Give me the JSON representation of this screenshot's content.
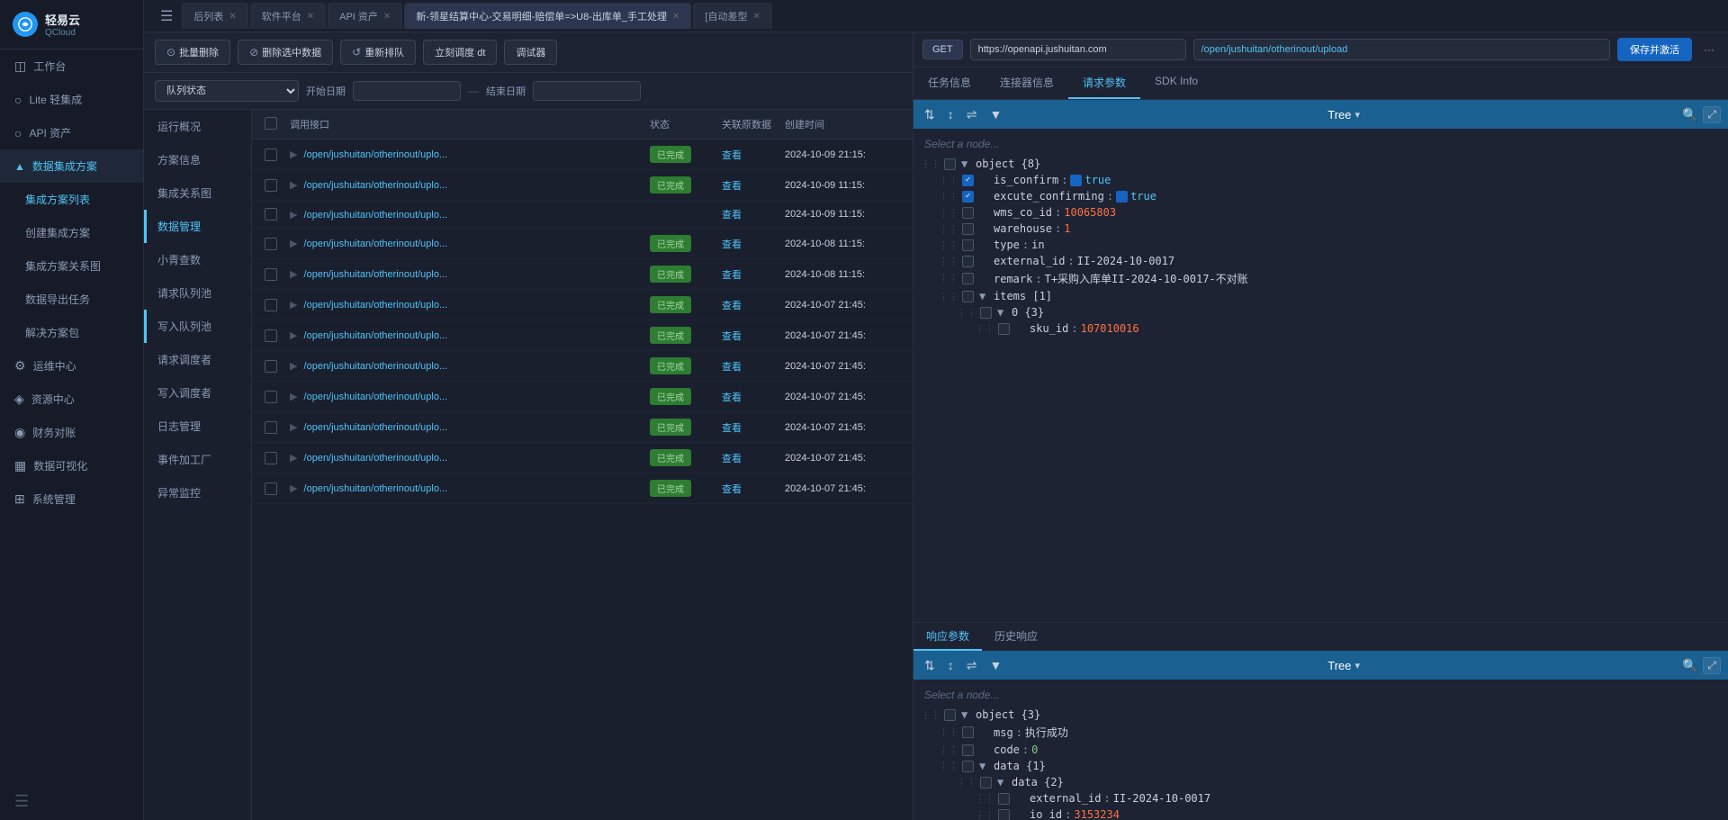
{
  "sidebar": {
    "logo": "轻易云",
    "logo_sub": "QCloud",
    "items": [
      {
        "id": "workspace",
        "label": "工作台",
        "icon": "◫"
      },
      {
        "id": "lite",
        "label": "Lite 轻集成",
        "icon": "○"
      },
      {
        "id": "api",
        "label": "API 资产",
        "icon": "○"
      },
      {
        "id": "integration",
        "label": "数据集成方案",
        "icon": "▲",
        "active": true,
        "expanded": true
      },
      {
        "id": "list",
        "label": "集成方案列表",
        "sub": true
      },
      {
        "id": "create",
        "label": "创建集成方案",
        "sub": true
      },
      {
        "id": "relation",
        "label": "集成方案关系图",
        "sub": true
      },
      {
        "id": "export",
        "label": "数据导出任务",
        "sub": true
      },
      {
        "id": "package",
        "label": "解决方案包",
        "sub": true
      },
      {
        "id": "ops",
        "label": "运维中心",
        "icon": "⚙"
      },
      {
        "id": "resource",
        "label": "资源中心",
        "icon": "◈"
      },
      {
        "id": "finance",
        "label": "财务对账",
        "icon": "◉"
      },
      {
        "id": "dataviz",
        "label": "数据可视化",
        "icon": "▦"
      },
      {
        "id": "system",
        "label": "系统管理",
        "icon": "⊞"
      }
    ]
  },
  "tabs": [
    {
      "label": "后列表",
      "closable": true
    },
    {
      "label": "软件平台",
      "closable": true
    },
    {
      "label": "API 资产",
      "closable": true
    },
    {
      "label": "新-领星结算中心-交易明细-赔偿单=>U8-出库单_手工处理",
      "closable": true,
      "active": true
    },
    {
      "label": "[自动差型",
      "closable": true
    }
  ],
  "toolbar": {
    "batch_delete": "批量删除",
    "delete_selected": "删除选中数据",
    "re_queue": "重新排队",
    "schedule_dt": "立刻调度 dt",
    "debug": "调试器"
  },
  "filter": {
    "queue_status_label": "队列状态",
    "start_date_label": "开始日期",
    "end_date_label": "结束日期",
    "separator": "—"
  },
  "sidebar_menu": {
    "items": [
      {
        "label": "运行概况"
      },
      {
        "label": "方案信息"
      },
      {
        "label": "集成关系图"
      },
      {
        "label": "数据管理",
        "active": true
      },
      {
        "label": "小青查数"
      },
      {
        "label": "请求队列池"
      },
      {
        "label": "写入队列池"
      },
      {
        "label": "请求调度者"
      },
      {
        "label": "写入调度者"
      },
      {
        "label": "日志管理"
      },
      {
        "label": "事件加工厂"
      },
      {
        "label": "异常监控"
      }
    ]
  },
  "table": {
    "headers": [
      "",
      "调用接口",
      "状态",
      "关联原数据",
      "创建时间"
    ],
    "rows": [
      {
        "api": "/open/jushuitan/otherinout/uplo...",
        "status": "已完成",
        "related": "查看",
        "time": "2024-10-09 21:15:"
      },
      {
        "api": "/open/jushuitan/otherinout/uplo...",
        "status": "已完成",
        "related": "查看",
        "time": "2024-10-09 11:15:"
      },
      {
        "api": "/open/jushuitan/otherinout/uplo...",
        "status": "",
        "related": "查看",
        "time": "2024-10-09 11:15:"
      },
      {
        "api": "/open/jushuitan/otherinout/uplo...",
        "status": "已完成",
        "related": "查看",
        "time": "2024-10-08 11:15:"
      },
      {
        "api": "/open/jushuitan/otherinout/uplo...",
        "status": "已完成",
        "related": "查看",
        "time": "2024-10-08 11:15:"
      },
      {
        "api": "/open/jushuitan/otherinout/uplo...",
        "status": "已完成",
        "related": "查看",
        "time": "2024-10-07 21:45:"
      },
      {
        "api": "/open/jushuitan/otherinout/uplo...",
        "status": "已完成",
        "related": "查看",
        "time": "2024-10-07 21:45:"
      },
      {
        "api": "/open/jushuitan/otherinout/uplo...",
        "status": "已完成",
        "related": "查看",
        "time": "2024-10-07 21:45:"
      },
      {
        "api": "/open/jushuitan/otherinout/uplo...",
        "status": "已完成",
        "related": "查看",
        "time": "2024-10-07 21:45:"
      },
      {
        "api": "/open/jushuitan/otherinout/uplo...",
        "status": "已完成",
        "related": "查看",
        "time": "2024-10-07 21:45:"
      },
      {
        "api": "/open/jushuitan/otherinout/uplo...",
        "status": "已完成",
        "related": "查看",
        "time": "2024-10-07 21:45:"
      },
      {
        "api": "/open/jushuitan/otherinout/uplo...",
        "status": "已完成",
        "related": "查看",
        "time": "2024-10-07 21:45:"
      }
    ]
  },
  "right_panel": {
    "method": "GET",
    "url": "https://openapi.jushuitan.com",
    "path": "/open/jushuitan/otherinout/upload",
    "save_btn": "保存并激活",
    "more": "···",
    "tabs": [
      "任务信息",
      "连接器信息",
      "请求参数",
      "SDK Info"
    ],
    "active_tab": "请求参数"
  },
  "request_tree": {
    "label": "Tree",
    "placeholder": "Select a node...",
    "nodes": [
      {
        "indent": 0,
        "key": "object {8}",
        "type": "object",
        "expand": true,
        "level": 0
      },
      {
        "indent": 1,
        "key": "is_confirm",
        "colon": ":",
        "val": "true",
        "val_type": "bool_checked",
        "level": 1
      },
      {
        "indent": 1,
        "key": "excute_confirming",
        "colon": ":",
        "val": "true",
        "val_type": "bool_checked",
        "level": 1
      },
      {
        "indent": 1,
        "key": "wms_co_id",
        "colon": ":",
        "val": "10065803",
        "val_type": "num",
        "level": 1
      },
      {
        "indent": 1,
        "key": "warehouse",
        "colon": ":",
        "val": "1",
        "val_type": "num",
        "level": 1
      },
      {
        "indent": 1,
        "key": "type",
        "colon": ":",
        "val": "in",
        "val_type": "str",
        "level": 1
      },
      {
        "indent": 1,
        "key": "external_id",
        "colon": ":",
        "val": "II-2024-10-0017",
        "val_type": "str",
        "level": 1
      },
      {
        "indent": 1,
        "key": "remark",
        "colon": ":",
        "val": "T+采购入库单II-2024-10-0017-不对账",
        "val_type": "str",
        "level": 1
      },
      {
        "indent": 1,
        "key": "items [1]",
        "expand": true,
        "level": 1
      },
      {
        "indent": 2,
        "key": "0  {3}",
        "expand": true,
        "level": 2
      },
      {
        "indent": 3,
        "key": "sku_id",
        "colon": ":",
        "val": "107010016",
        "val_type": "num",
        "level": 3
      }
    ]
  },
  "response_tabs": [
    "响应参数",
    "历史响应"
  ],
  "response_tree": {
    "label": "Tree",
    "placeholder": "Select a node...",
    "nodes": [
      {
        "indent": 0,
        "key": "object {3}",
        "expand": true,
        "level": 0
      },
      {
        "indent": 1,
        "key": "msg",
        "colon": ":",
        "val": "执行成功",
        "val_type": "str",
        "level": 1
      },
      {
        "indent": 1,
        "key": "code",
        "colon": ":",
        "val": "0",
        "val_type": "num_green",
        "level": 1
      },
      {
        "indent": 1,
        "key": "data {1}",
        "expand": true,
        "level": 1
      },
      {
        "indent": 2,
        "key": "data {2}",
        "expand": true,
        "level": 2
      },
      {
        "indent": 3,
        "key": "external_id",
        "colon": ":",
        "val": "II-2024-10-0017",
        "val_type": "str",
        "level": 3
      },
      {
        "indent": 3,
        "key": "io_id",
        "colon": ":",
        "val": "3153234",
        "val_type": "num",
        "level": 3
      }
    ]
  }
}
